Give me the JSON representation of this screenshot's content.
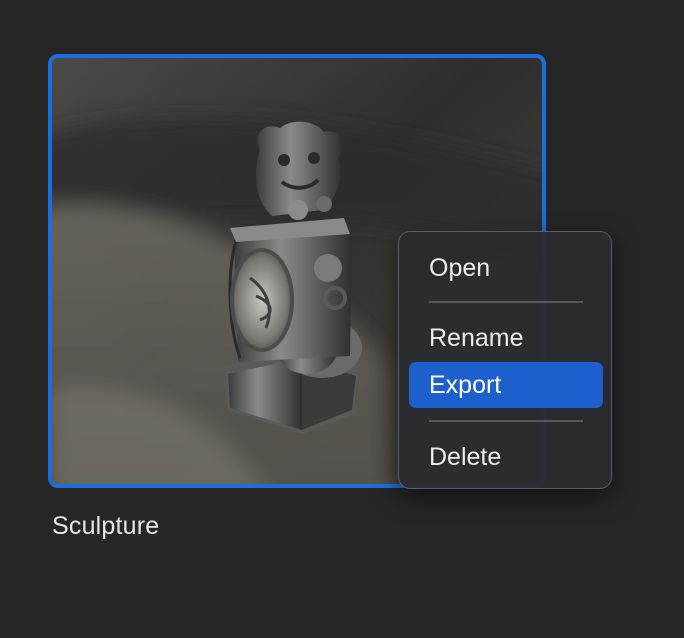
{
  "item": {
    "name": "Sculpture",
    "thumbnail_icon": "sculpture-thumbnail",
    "selection_color": "#1a6fe0"
  },
  "context_menu": {
    "items": [
      {
        "label": "Open",
        "selected": false
      },
      {
        "label": "Rename",
        "selected": false
      },
      {
        "label": "Export",
        "selected": true
      },
      {
        "label": "Delete",
        "selected": false
      }
    ],
    "highlight_color": "#1d5fcc"
  }
}
